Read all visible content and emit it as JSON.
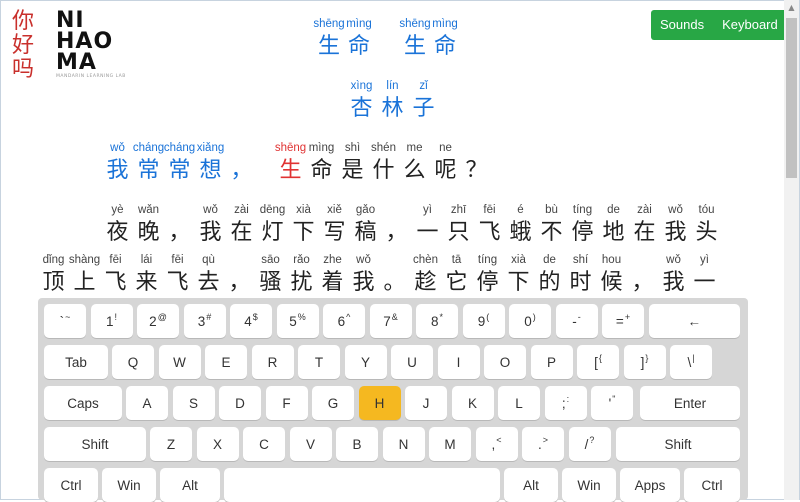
{
  "header_buttons": {
    "sounds": "Sounds",
    "keyboard": "Keyboard"
  },
  "logo": {
    "char": "你好吗",
    "line1": "NI",
    "line2": "HAO",
    "line3": "MA",
    "tag": "MANDARIN LEARNING LAB"
  },
  "title": {
    "pinyin": [
      "shēng",
      "mìng",
      "shēng",
      "mìng"
    ],
    "chars": [
      "生",
      "命",
      "生",
      "命"
    ]
  },
  "author": {
    "pinyin": [
      "xìng",
      "lín",
      "zǐ"
    ],
    "chars": [
      "杏",
      "林",
      "子"
    ]
  },
  "lines": [
    {
      "pinyin": [
        "wǒ",
        "cháng",
        "cháng",
        "xiǎng",
        "",
        "shēng",
        "mìng",
        "shì",
        "shén",
        "me",
        "ne",
        ""
      ],
      "chars": [
        "我",
        "常",
        "常",
        "想",
        "，",
        "生",
        "命",
        "是",
        "什",
        "么",
        "呢",
        "？"
      ]
    },
    {
      "pinyin": [
        "yè",
        "wǎn",
        "",
        "wǒ",
        "zài",
        "dēng",
        "xià",
        "xiě",
        "gǎo",
        "",
        "yì",
        "zhī",
        "fēi",
        "é",
        "bù",
        "tíng",
        "de",
        "zài",
        "wǒ",
        "tóu"
      ],
      "chars": [
        "夜",
        "晚",
        "，",
        "我",
        "在",
        "灯",
        "下",
        "写",
        "稿",
        "，",
        "一",
        "只",
        "飞",
        "蛾",
        "不",
        "停",
        "地",
        "在",
        "我",
        "头"
      ]
    },
    {
      "pinyin": [
        "dǐng",
        "shàng",
        "fēi",
        "lái",
        "fēi",
        "qù",
        "",
        "sāo",
        "rǎo",
        "zhe",
        "wǒ",
        "",
        "chèn",
        "tā",
        "tíng",
        "xià",
        "de",
        "shí",
        "hou",
        "",
        "wǒ",
        "yì"
      ],
      "chars": [
        "顶",
        "上",
        "飞",
        "来",
        "飞",
        "去",
        "，",
        "骚",
        "扰",
        "着",
        "我",
        "。",
        "趁",
        "它",
        "停",
        "下",
        "的",
        "时",
        "候",
        "，",
        "我",
        "一"
      ]
    }
  ],
  "keyboard": {
    "row1": [
      {
        "main": "`",
        "sup": "~"
      },
      {
        "main": "1",
        "sup": "!"
      },
      {
        "main": "2",
        "sup": "@"
      },
      {
        "main": "3",
        "sup": "#"
      },
      {
        "main": "4",
        "sup": "$"
      },
      {
        "main": "5",
        "sup": "%"
      },
      {
        "main": "6",
        "sup": "^"
      },
      {
        "main": "7",
        "sup": "&"
      },
      {
        "main": "8",
        "sup": "*"
      },
      {
        "main": "9",
        "sup": "("
      },
      {
        "main": "0",
        "sup": ")"
      },
      {
        "main": "-",
        "sup": "-"
      },
      {
        "main": "=",
        "sup": "+"
      },
      {
        "main": "←",
        "sup": ""
      }
    ],
    "row2": [
      "Tab",
      "Q",
      "W",
      "E",
      "R",
      "T",
      "Y",
      "U",
      "I",
      "O",
      "P",
      "[{",
      "]}",
      "\\|"
    ],
    "row2_display": [
      {
        "main": "Tab",
        "sup": ""
      },
      {
        "main": "Q",
        "sup": ""
      },
      {
        "main": "W",
        "sup": ""
      },
      {
        "main": "E",
        "sup": ""
      },
      {
        "main": "R",
        "sup": ""
      },
      {
        "main": "T",
        "sup": ""
      },
      {
        "main": "Y",
        "sup": ""
      },
      {
        "main": "U",
        "sup": ""
      },
      {
        "main": "I",
        "sup": ""
      },
      {
        "main": "O",
        "sup": ""
      },
      {
        "main": "P",
        "sup": ""
      },
      {
        "main": "[",
        "sup": "{"
      },
      {
        "main": "]",
        "sup": "}"
      },
      {
        "main": "\\",
        "sup": "|"
      }
    ],
    "row3": [
      {
        "main": "Caps",
        "sup": ""
      },
      {
        "main": "A",
        "sup": ""
      },
      {
        "main": "S",
        "sup": ""
      },
      {
        "main": "D",
        "sup": ""
      },
      {
        "main": "F",
        "sup": ""
      },
      {
        "main": "G",
        "sup": ""
      },
      {
        "main": "H",
        "sup": ""
      },
      {
        "main": "J",
        "sup": ""
      },
      {
        "main": "K",
        "sup": ""
      },
      {
        "main": "L",
        "sup": ""
      },
      {
        "main": ";",
        "sup": ":"
      },
      {
        "main": "'",
        "sup": "\""
      },
      {
        "main": "Enter",
        "sup": ""
      }
    ],
    "row4": [
      {
        "main": "Shift",
        "sup": ""
      },
      {
        "main": "Z",
        "sup": ""
      },
      {
        "main": "X",
        "sup": ""
      },
      {
        "main": "C",
        "sup": ""
      },
      {
        "main": "V",
        "sup": ""
      },
      {
        "main": "B",
        "sup": ""
      },
      {
        "main": "N",
        "sup": ""
      },
      {
        "main": "M",
        "sup": ""
      },
      {
        "main": ",",
        "sup": "<"
      },
      {
        "main": ".",
        "sup": ">"
      },
      {
        "main": "/",
        "sup": "?"
      },
      {
        "main": "Shift",
        "sup": ""
      }
    ],
    "row5": [
      {
        "main": "Ctrl",
        "sup": ""
      },
      {
        "main": "Win",
        "sup": ""
      },
      {
        "main": "Alt",
        "sup": ""
      },
      {
        "main": "",
        "sup": ""
      },
      {
        "main": "Alt",
        "sup": ""
      },
      {
        "main": "Win",
        "sup": ""
      },
      {
        "main": "Apps",
        "sup": ""
      },
      {
        "main": "Ctrl",
        "sup": ""
      }
    ],
    "active_key": "H",
    "active_color": "#f5b820"
  },
  "colors": {
    "highlight_blue": "#1a73d8",
    "highlight_red": "#e03333",
    "button_green": "#28a745"
  }
}
